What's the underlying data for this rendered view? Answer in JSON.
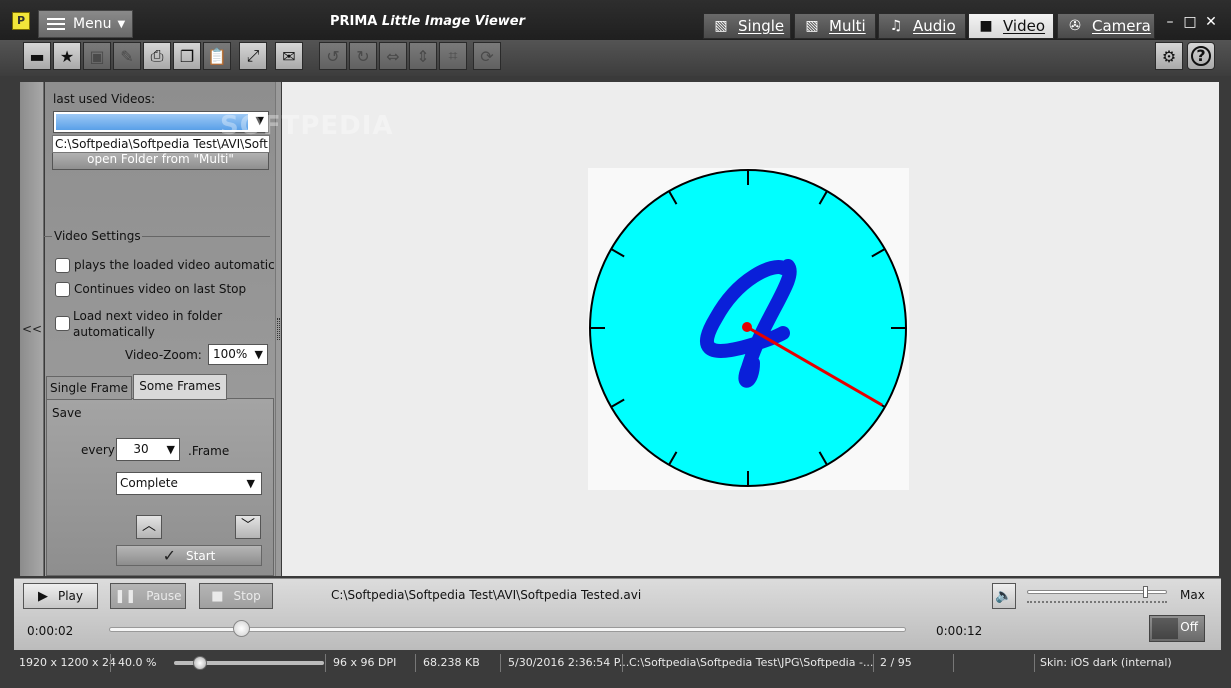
{
  "window": {
    "app_icon": "P",
    "menu_label": "Menu",
    "title_brand": "PRIMA",
    "title_name": "Little Image Viewer",
    "mode_tabs": [
      {
        "label": "Single",
        "icon": "image-icon"
      },
      {
        "label": "Multi",
        "icon": "images-icon"
      },
      {
        "label": "Audio",
        "icon": "music-note-icon"
      },
      {
        "label": "Video",
        "icon": "video-camera-icon"
      },
      {
        "label": "Camera",
        "icon": "camera-aperture-icon"
      }
    ],
    "active_tab": "Video",
    "controls": {
      "minimize": "–",
      "maximize": "□",
      "close": "✕"
    }
  },
  "toolbar": {
    "buttons": [
      {
        "name": "open-folder-icon",
        "glyph": "▬"
      },
      {
        "name": "favorite-folder-icon",
        "glyph": "★"
      },
      {
        "name": "save-icon",
        "glyph": "▣"
      },
      {
        "name": "edit-pencil-icon",
        "glyph": "✎"
      },
      {
        "name": "print-icon",
        "glyph": "⎙"
      },
      {
        "name": "copy-icon",
        "glyph": "❐"
      },
      {
        "name": "paste-icon",
        "glyph": "📋"
      },
      {
        "name": "fullscreen-icon",
        "glyph": "⤢"
      },
      {
        "name": "email-icon",
        "glyph": "✉"
      },
      {
        "name": "rotate-left-icon",
        "glyph": "↺"
      },
      {
        "name": "rotate-right-icon",
        "glyph": "↻"
      },
      {
        "name": "flip-horizontal-icon",
        "glyph": "⇔"
      },
      {
        "name": "flip-vertical-icon",
        "glyph": "⇕"
      },
      {
        "name": "crop-icon",
        "glyph": "⌗"
      },
      {
        "name": "refresh-icon",
        "glyph": "⟳"
      }
    ],
    "settings_glyph": "⚙",
    "help_glyph": "?"
  },
  "left_panel": {
    "collapse_label": "<<",
    "recent_label": "last used Videos:",
    "recent_item": "C:\\Softpedia\\Softpedia Test\\AVI\\Softpedia Tested.avi",
    "open_folder_label": "open Folder from \"Multi\"",
    "video_settings_label": "Video Settings",
    "checkboxes": [
      {
        "label": "plays the loaded video automatically",
        "checked": false
      },
      {
        "label": "Continues video on last Stop",
        "checked": false
      },
      {
        "label": "Load next video in folder automatically",
        "checked": false
      }
    ],
    "video_zoom_label": "Video-Zoom:",
    "video_zoom_value": "100%",
    "tabs": [
      "Single Frame",
      "Some Frames"
    ],
    "active_subtab": "Some Frames",
    "save_label": "Save",
    "every_label": "every",
    "every_value": "30",
    "frame_label": ".Frame",
    "mode_value": "Complete",
    "start_label": "Start"
  },
  "viewer": {
    "watermark": "SOFTPEDIA",
    "clock_digit": "4",
    "colors": {
      "face": "#00ffff",
      "digit": "#0a1fd9",
      "hand": "#e60000"
    }
  },
  "player": {
    "play_label": "Play",
    "pause_label": "Pause",
    "stop_label": "Stop",
    "file_path": "C:\\Softpedia\\Softpedia Test\\AVI\\Softpedia Tested.avi",
    "volume_max_label": "Max",
    "volume_level": 0.83,
    "time_current": "0:00:02",
    "time_total": "0:00:12",
    "progress": 0.167,
    "toggle_label": "Off"
  },
  "status": {
    "resolution": "1920 x 1200 x 24",
    "zoom": "40.0 %",
    "dpi": "96 x 96 DPI",
    "file_size": "68.238 KB",
    "date": "5/30/2016 2:36:54 P...",
    "path": "C:\\Softpedia\\Softpedia Test\\JPG\\Softpedia -...",
    "index": "2 / 95",
    "skin": "Skin: iOS dark (internal)"
  }
}
